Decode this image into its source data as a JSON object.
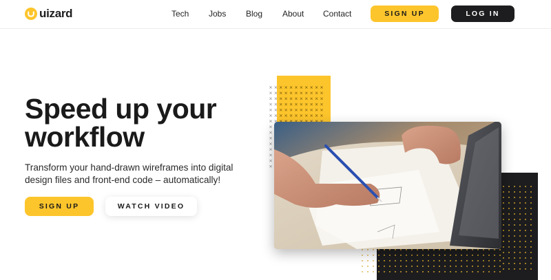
{
  "brand": {
    "name": "uizard",
    "accent": "#FDC52C",
    "dark": "#1d1d1f"
  },
  "nav": {
    "links": [
      "Tech",
      "Jobs",
      "Blog",
      "About",
      "Contact"
    ],
    "signup_label": "SIGN UP",
    "login_label": "LOG IN"
  },
  "hero": {
    "title_line1": "Speed up your",
    "title_line2": "workflow",
    "subtitle_line1": "Transform your hand-drawn wireframes into digital",
    "subtitle_line2": "design files and front-end code – automatically!",
    "signup_label": "SIGN UP",
    "watch_label": "WATCH VIDEO"
  },
  "media": {
    "photo_icon": "hand-sketching-wireframe-photo"
  }
}
